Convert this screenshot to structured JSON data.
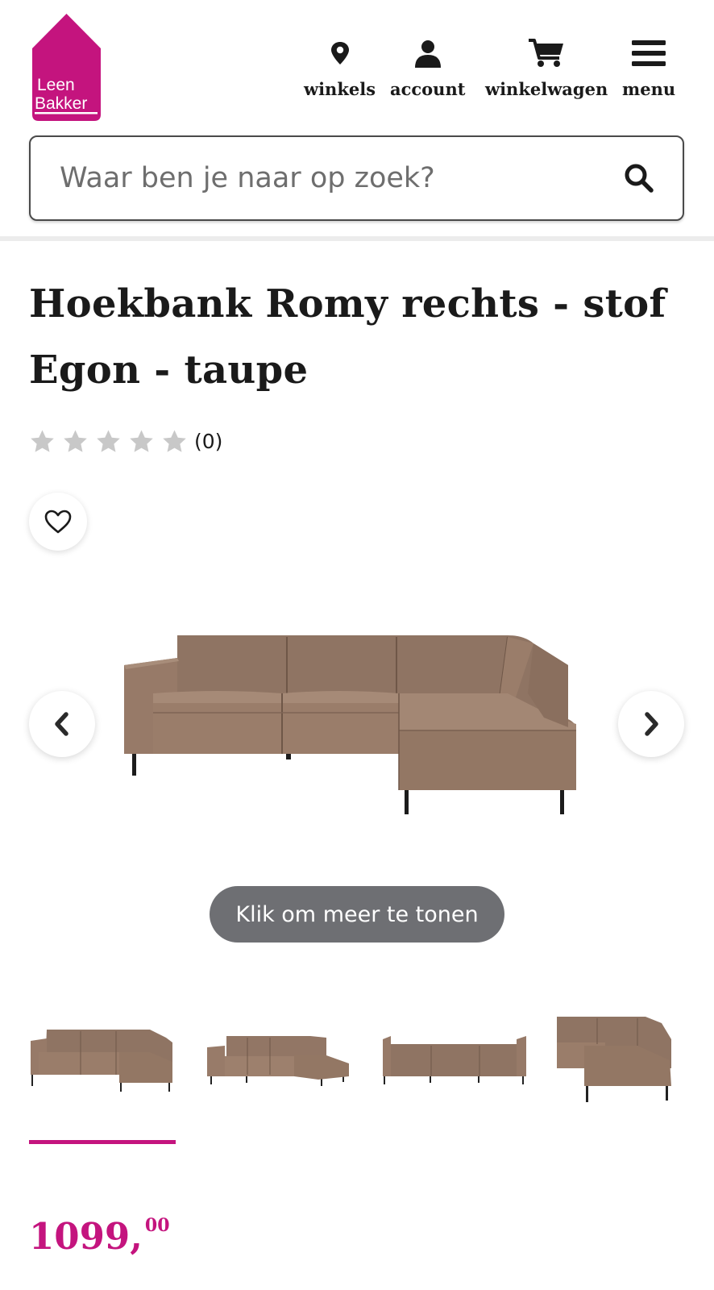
{
  "brand": {
    "logo_line1": "Leen",
    "logo_line2": "Bakker",
    "color": "#c4147e"
  },
  "nav": {
    "stores": {
      "label": "winkels",
      "icon": "map-pin-icon"
    },
    "account": {
      "label": "account",
      "icon": "user-icon"
    },
    "cart": {
      "label": "winkelwagen",
      "icon": "cart-icon"
    },
    "menu": {
      "label": "menu",
      "icon": "hamburger-icon"
    }
  },
  "search": {
    "placeholder": "Waar ben je naar op zoek?",
    "value": "",
    "icon": "search-icon"
  },
  "product": {
    "title": "Hoekbank Romy rechts - stof Egon - taupe",
    "rating": {
      "stars": 0,
      "max": 5,
      "count_label": "(0)"
    },
    "price": {
      "euros": "1099,",
      "cents": "00"
    },
    "color": "#8f7463"
  },
  "gallery": {
    "show_more_label": "Klik om meer te tonen",
    "active_thumb": 1,
    "thumb_count": 4
  }
}
